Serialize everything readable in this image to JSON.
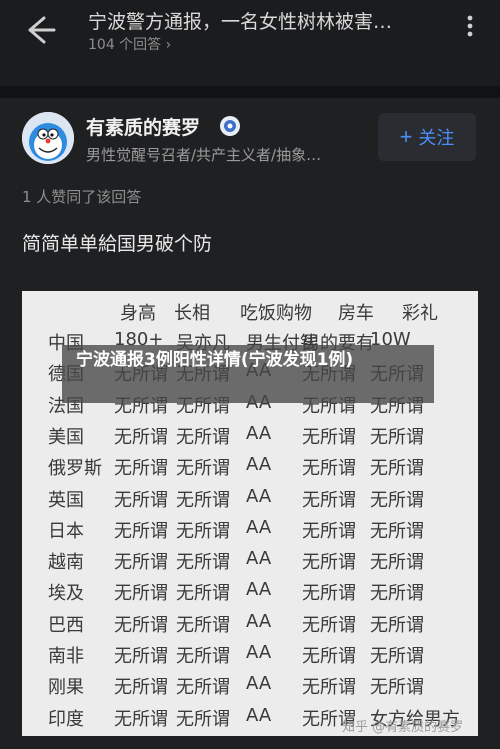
{
  "header": {
    "question_title": "宁波警方通报，一名女性树林被害…",
    "answers_count": "104 个回答",
    "answers_chevron": "›"
  },
  "answer": {
    "author_name": "有素质的赛罗",
    "author_bio": "男性觉醒号召者/共产主义者/抽象…",
    "follow_label": "关注",
    "follow_plus": "+",
    "likes": "1 人赞同了该回答",
    "text": "简简单单給国男破个防"
  },
  "table": {
    "headers": [
      "身高",
      "长相",
      "吃饭购物",
      "房车",
      "彩礼"
    ],
    "rows": [
      {
        "country": "中国",
        "c1": "180+",
        "c2": "吴亦凡",
        "c3": "男生付钱",
        "c4": "男的要有",
        "c5": "10W"
      },
      {
        "country": "德国",
        "c1": "无所谓",
        "c2": "无所谓",
        "c3": "AA",
        "c4": "无所谓",
        "c5": "无所谓"
      },
      {
        "country": "法国",
        "c1": "无所谓",
        "c2": "无所谓",
        "c3": "AA",
        "c4": "无所谓",
        "c5": "无所谓"
      },
      {
        "country": "美国",
        "c1": "无所谓",
        "c2": "无所谓",
        "c3": "AA",
        "c4": "无所谓",
        "c5": "无所谓"
      },
      {
        "country": "俄罗斯",
        "c1": "无所谓",
        "c2": "无所谓",
        "c3": "AA",
        "c4": "无所谓",
        "c5": "无所谓"
      },
      {
        "country": "英国",
        "c1": "无所谓",
        "c2": "无所谓",
        "c3": "AA",
        "c4": "无所谓",
        "c5": "无所谓"
      },
      {
        "country": "日本",
        "c1": "无所谓",
        "c2": "无所谓",
        "c3": "AA",
        "c4": "无所谓",
        "c5": "无所谓"
      },
      {
        "country": "越南",
        "c1": "无所谓",
        "c2": "无所谓",
        "c3": "AA",
        "c4": "无所谓",
        "c5": "无所谓"
      },
      {
        "country": "埃及",
        "c1": "无所谓",
        "c2": "无所谓",
        "c3": "AA",
        "c4": "无所谓",
        "c5": "无所谓"
      },
      {
        "country": "巴西",
        "c1": "无所谓",
        "c2": "无所谓",
        "c3": "AA",
        "c4": "无所谓",
        "c5": "无所谓"
      },
      {
        "country": "南非",
        "c1": "无所谓",
        "c2": "无所谓",
        "c3": "AA",
        "c4": "无所谓",
        "c5": "无所谓"
      },
      {
        "country": "刚果",
        "c1": "无所谓",
        "c2": "无所谓",
        "c3": "AA",
        "c4": "无所谓",
        "c5": "无所谓"
      },
      {
        "country": "印度",
        "c1": "无所谓",
        "c2": "无所谓",
        "c3": "AA",
        "c4": "无所谓",
        "c5": "女方给男方"
      }
    ]
  },
  "overlay_caption": "宁波通报3例阳性详情(宁波发现1例)",
  "watermark": "知乎 @有素质的赛罗",
  "colors": {
    "background": "#1b1c1e",
    "accent_blue": "#4d8df7",
    "table_bg": "#ececec"
  },
  "icons": [
    "back-arrow-icon",
    "more-options-icon",
    "verified-badge-icon",
    "plus-icon"
  ]
}
